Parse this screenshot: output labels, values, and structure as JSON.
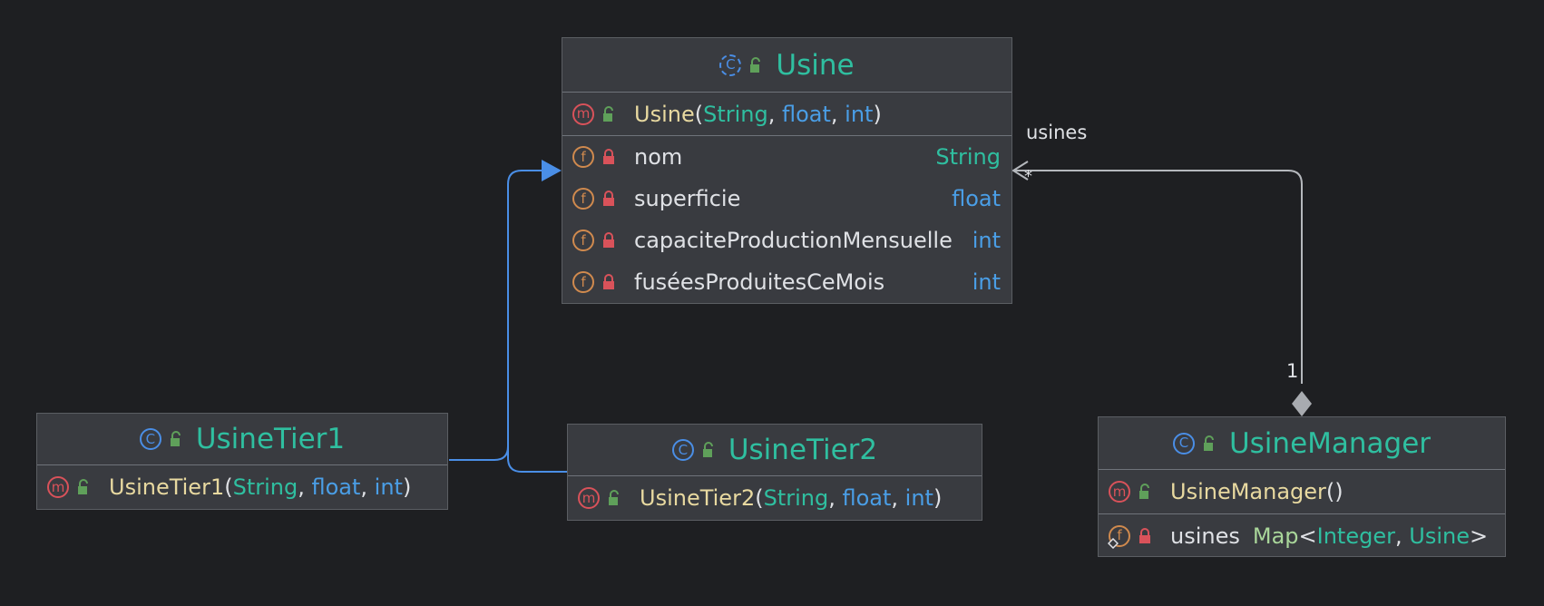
{
  "classes": {
    "usine": {
      "name": "Usine",
      "constructor": {
        "name": "Usine",
        "open": "(",
        "p1": "String",
        "c1": ", ",
        "p2": "float",
        "c2": ", ",
        "p3": "int",
        "close": ")"
      },
      "fields": [
        {
          "name": "nom",
          "type": "String"
        },
        {
          "name": "superficie",
          "type": "float"
        },
        {
          "name": "capaciteProductionMensuelle",
          "type": "int"
        },
        {
          "name": "fuséesProduitesCeMois",
          "type": "int"
        }
      ]
    },
    "usineTier1": {
      "name": "UsineTier1",
      "constructor": {
        "name": "UsineTier1",
        "open": "(",
        "p1": "String",
        "c1": ", ",
        "p2": "float",
        "c2": ", ",
        "p3": "int",
        "close": ")"
      }
    },
    "usineTier2": {
      "name": "UsineTier2",
      "constructor": {
        "name": "UsineTier2",
        "open": "(",
        "p1": "String",
        "c1": ", ",
        "p2": "float",
        "c2": ", ",
        "p3": "int",
        "close": ")"
      }
    },
    "usineManager": {
      "name": "UsineManager",
      "constructor": {
        "name": "UsineManager",
        "parens": "()"
      },
      "field": {
        "name": "usines",
        "type_map": "Map",
        "lt": "<",
        "k": "Integer",
        "comma": ", ",
        "v": "Usine",
        "gt": ">"
      }
    }
  },
  "icons": {
    "class": "C",
    "method": "m",
    "field": "f"
  },
  "relations": {
    "association_role": "usines",
    "multiplicity_target": "*",
    "multiplicity_source": "1"
  },
  "colors": {
    "background": "#1e1f22",
    "node": "#393b40",
    "class_name": "#2fbfa0",
    "primitive": "#4a9ee6",
    "method": "#e8d9a0",
    "inheritance_edge": "#4a8ee6",
    "association_edge": "#b5b8bd"
  }
}
